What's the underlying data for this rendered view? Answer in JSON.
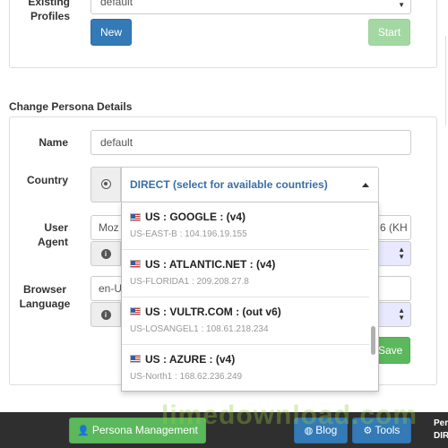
{
  "profiles": {
    "label_line1": "Existing",
    "label_line2": "Profiles",
    "selected": "default",
    "new_button": "New",
    "start_button": "Start"
  },
  "persona": {
    "section_title": "Change Persona Details",
    "name_label": "Name",
    "name_value": "default",
    "country_label": "Country",
    "country_value": "DIRECT (select for available countries)",
    "user_agent_label_line1": "User",
    "user_agent_label_line2": "Agent",
    "user_agent_value_start": "Moz",
    "user_agent_value_end": "6 (KH",
    "browser_language_label_line1": "Browser",
    "browser_language_label_line2": "Language",
    "browser_language_value": "en-U",
    "save_button": "Save"
  },
  "dropdown": {
    "items": [
      {
        "title": "US : GOOGLE : (v4)",
        "subtitle": "US-EAST-B : 104.196.19.155"
      },
      {
        "title": "US : ATLANTIC.NET : (v4)",
        "subtitle": "US-FLORIDA1 : 209.208.27.8"
      },
      {
        "title": "US : VULTR.COM : (out v6)",
        "subtitle": "US-LOSANGEL1 : 108.61.218.234"
      },
      {
        "title": "US : AZURE : (v4)",
        "subtitle": "US-North1 : 168.62.236.249"
      }
    ]
  },
  "bottom_bar": {
    "persona_management": "Persona Management",
    "blog": "Blog",
    "tools": "Tools",
    "side_line1": "Per",
    "side_line2": "DIR"
  },
  "watermark": "limedownload.com",
  "colors": {
    "primary": "#337ab7",
    "success": "#5cb85c",
    "bottom_bar": "#2f2f2f"
  }
}
